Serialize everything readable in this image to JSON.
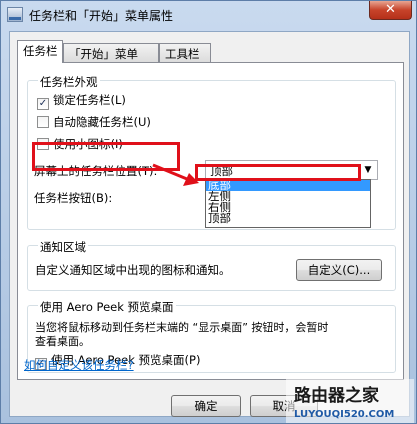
{
  "window": {
    "title": "任务栏和「开始」菜单属性",
    "close_glyph": "✕"
  },
  "tabs": [
    {
      "label": "任务栏",
      "active": true
    },
    {
      "label": "「开始」菜单",
      "active": false
    },
    {
      "label": "工具栏",
      "active": false
    }
  ],
  "appearance": {
    "title": "任务栏外观",
    "lock": {
      "label": "锁定任务栏(L)",
      "checked": true
    },
    "autohide": {
      "label": "自动隐藏任务栏(U)",
      "checked": false
    },
    "small_icons": {
      "label": "使用小图标(I)",
      "checked": false
    },
    "position_label": "屏幕上的任务栏位置(T):",
    "position_value": "顶部",
    "position_options": [
      "底部",
      "左侧",
      "右侧",
      "顶部"
    ],
    "buttons_label": "任务栏按钮(B):"
  },
  "notify": {
    "title": "通知区域",
    "desc": "自定义通知区域中出现的图标和通知。",
    "customize_button": "自定义(C)..."
  },
  "aero": {
    "title": "使用 Aero Peek 预览桌面",
    "desc_line1": "当您将鼠标移动到任务栏末端的 “显示桌面” 按钮时，会暂时",
    "desc_line2": "查看桌面。",
    "checkbox": {
      "label": "使用 Aero Peek 预览桌面(P)",
      "checked": true
    }
  },
  "help_link": "如何自定义该任务栏?",
  "footer": {
    "ok": "确定",
    "cancel": "取消"
  },
  "watermark": {
    "text_main": "路由器之家",
    "text_url": "LUYOUQI520.COM"
  },
  "colors": {
    "annotation_red": "#e0101a",
    "selection_blue": "#3399ff",
    "link_blue": "#0066cc"
  }
}
